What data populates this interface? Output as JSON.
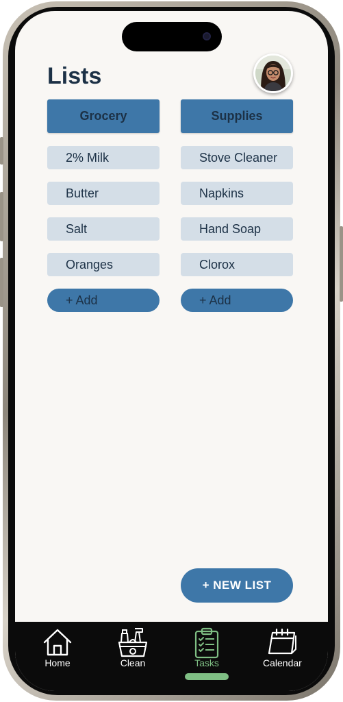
{
  "header": {
    "title": "Lists",
    "avatar_icon": "user-avatar"
  },
  "lists": [
    {
      "name": "Grocery",
      "items": [
        "2% Milk",
        "Butter",
        "Salt",
        "Oranges"
      ],
      "add_label": "+ Add"
    },
    {
      "name": "Supplies",
      "items": [
        "Stove Cleaner",
        "Napkins",
        "Hand Soap",
        "Clorox"
      ],
      "add_label": "+ Add"
    }
  ],
  "new_list_label": "+ NEW LIST",
  "tabs": [
    {
      "label": "Home",
      "icon": "house-icon",
      "active": false
    },
    {
      "label": "Clean",
      "icon": "cleaning-basket-icon",
      "active": false
    },
    {
      "label": "Tasks",
      "icon": "clipboard-checklist-icon",
      "active": true
    },
    {
      "label": "Calendar",
      "icon": "calendar-icon",
      "active": false
    }
  ],
  "colors": {
    "primary": "#3e77a8",
    "item_bg": "#d4dee7",
    "text": "#1c3146",
    "active_tab": "#7fbf84",
    "background": "#f9f7f4"
  }
}
